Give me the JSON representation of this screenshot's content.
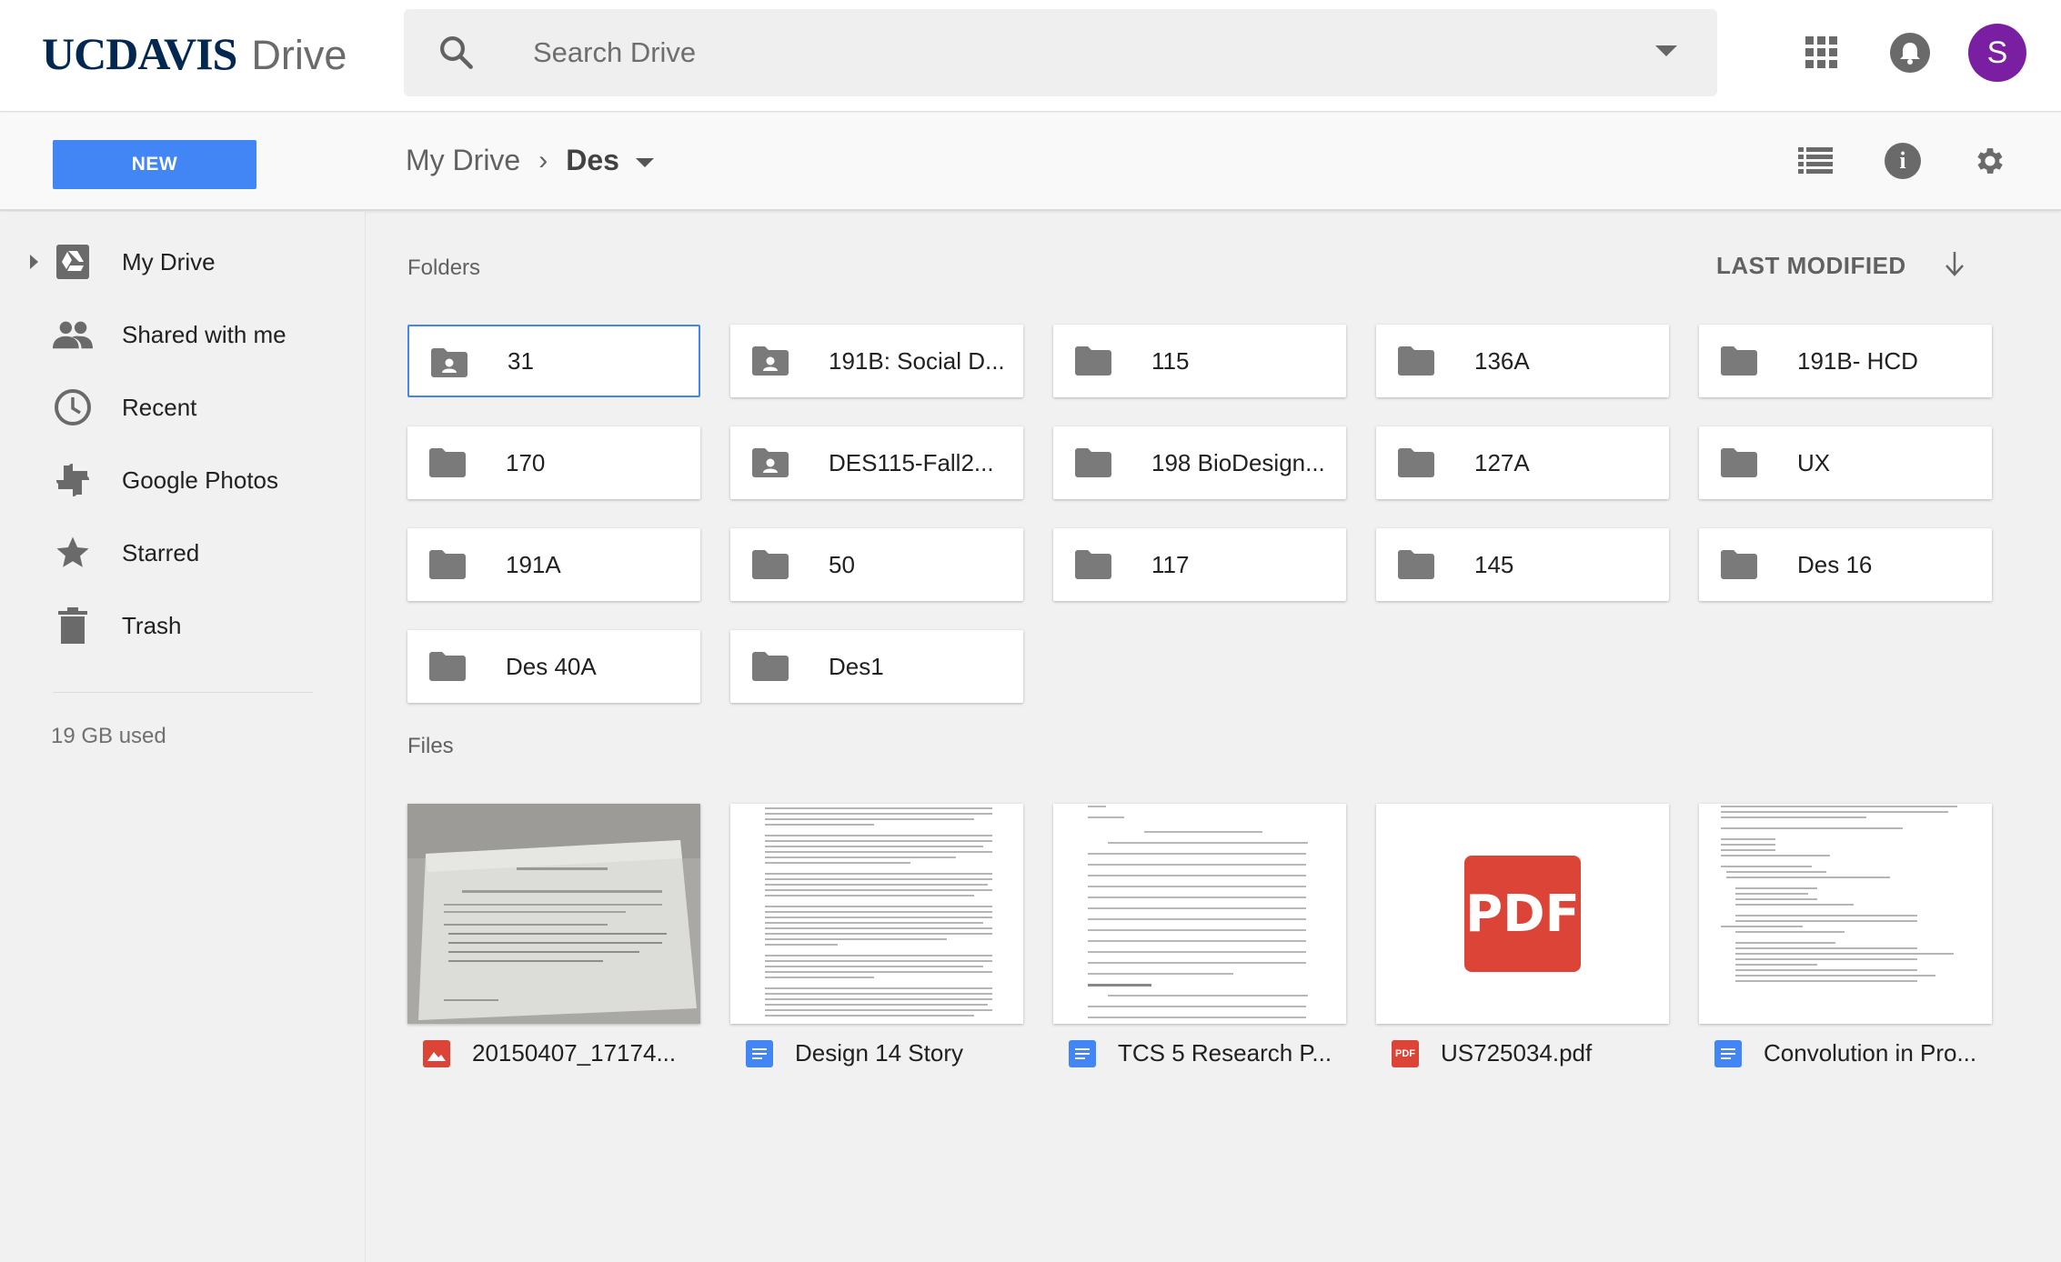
{
  "header": {
    "logo_primary": "UCDAVIS",
    "logo_secondary": "Drive",
    "search_placeholder": "Search Drive",
    "avatar_letter": "S",
    "avatar_color": "#7b1fa2"
  },
  "toolbar": {
    "new_label": "NEW",
    "breadcrumb": [
      "My Drive",
      "Des"
    ]
  },
  "sidebar": {
    "items": [
      {
        "label": "My Drive",
        "icon": "drive-icon"
      },
      {
        "label": "Shared with me",
        "icon": "people-icon"
      },
      {
        "label": "Recent",
        "icon": "clock-icon"
      },
      {
        "label": "Google Photos",
        "icon": "pinwheel-icon"
      },
      {
        "label": "Starred",
        "icon": "star-icon"
      },
      {
        "label": "Trash",
        "icon": "trash-icon"
      }
    ],
    "storage": "19 GB used"
  },
  "main": {
    "folders_label": "Folders",
    "files_label": "Files",
    "sort_label": "LAST MODIFIED",
    "folders": [
      {
        "name": "31",
        "shared": true,
        "selected": true
      },
      {
        "name": "191B: Social D...",
        "shared": true
      },
      {
        "name": "115",
        "shared": false
      },
      {
        "name": "136A",
        "shared": false
      },
      {
        "name": "191B- HCD",
        "shared": false
      },
      {
        "name": "170",
        "shared": false
      },
      {
        "name": "DES115-Fall2...",
        "shared": true
      },
      {
        "name": "198 BioDesign...",
        "shared": false
      },
      {
        "name": "127A",
        "shared": false
      },
      {
        "name": "UX",
        "shared": false
      },
      {
        "name": "191A",
        "shared": false
      },
      {
        "name": "50",
        "shared": false
      },
      {
        "name": "117",
        "shared": false
      },
      {
        "name": "145",
        "shared": false
      },
      {
        "name": "Des 16",
        "shared": false
      },
      {
        "name": "Des 40A",
        "shared": false
      },
      {
        "name": "Des1",
        "shared": false
      }
    ],
    "files": [
      {
        "name": "20150407_17174...",
        "type": "image",
        "icon_color": "#db4437"
      },
      {
        "name": "Design 14 Story",
        "type": "doc",
        "icon_color": "#4285f4"
      },
      {
        "name": "TCS 5 Research P...",
        "type": "doc",
        "icon_color": "#4285f4"
      },
      {
        "name": "US725034.pdf",
        "type": "pdf",
        "icon_color": "#db4437",
        "thumb_text": "PDF"
      },
      {
        "name": "Convolution in Pro...",
        "type": "doc",
        "icon_color": "#4285f4"
      }
    ]
  }
}
